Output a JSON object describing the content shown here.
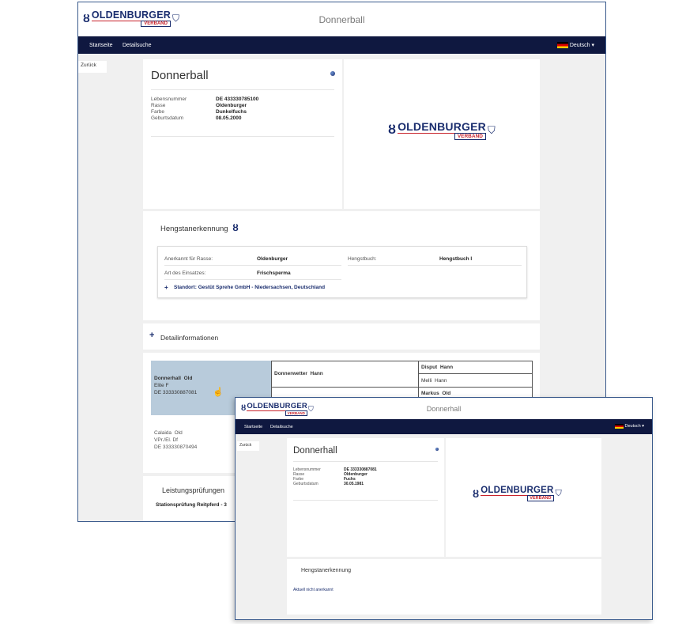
{
  "brand": {
    "name": "OLDENBURGER",
    "sub": "VERBAND"
  },
  "icons": {
    "emblem": "horse-emblem-icon",
    "shield": "shield-icon",
    "expand": "plus-icon",
    "cursor": "hand-cursor-icon"
  },
  "colors": {
    "navbar": "#0f1840",
    "accent_red": "#c8232c",
    "brand_blue": "#1a2d6e",
    "highlight": "#b8cbdb"
  },
  "nav": {
    "home": "Startseite",
    "search": "Detailsuche",
    "language": "Deutsch ▾"
  },
  "back": "Zurück",
  "window1": {
    "title": "Donnerball",
    "horse": {
      "name": "Donnerball",
      "fields": [
        {
          "label": "Lebensnummer",
          "value": "DE 433330785100"
        },
        {
          "label": "Rasse",
          "value": "Oldenburger"
        },
        {
          "label": "Farbe",
          "value": "Dunkelfuchs"
        },
        {
          "label": "Geburtsdatum",
          "value": "08.05.2000"
        }
      ]
    },
    "hengst": {
      "title": "Hengstanerkennung",
      "anerkannt_label": "Anerkannt für Rasse:",
      "anerkannt_value": "Oldenburger",
      "hengstbuch_label": "Hengstbuch:",
      "hengstbuch_value": "Hengstbuch I",
      "einsatz_label": "Art des Einsatzes:",
      "einsatz_value": "Frischsperma",
      "standort": "Standort: Gestüt Sprehe GmbH - Niedersachsen, Deutschland"
    },
    "details": "Detailinformationen",
    "pedigree": {
      "sire_name": "Donnerhall",
      "sire_breed": "Old",
      "sire_line2": "Elite  F",
      "sire_number": "DE 333330887081",
      "gs_name": "Donnerwetter",
      "gs_breed": "Hann",
      "ggs1_name": "Disput",
      "ggs1_breed": "Hann",
      "ggd1_name": "Melli",
      "ggd1_breed": "Hann",
      "ggs2_name": "Markus",
      "ggs2_breed": "Old",
      "dam_name": "Calaida",
      "dam_breed": "Old",
      "dam_line2": "VPr./El.  Df",
      "dam_number": "DE 333330870494"
    },
    "leistung": {
      "title": "Leistungsprüfungen",
      "item": "Stationsprüfung Reitpferd - 3"
    }
  },
  "window2": {
    "title": "Donnerhall",
    "horse": {
      "name": "Donnerhall",
      "fields": [
        {
          "label": "Lebensnummer",
          "value": "DE 333330887081"
        },
        {
          "label": "Rasse",
          "value": "Oldenburger"
        },
        {
          "label": "Farbe",
          "value": "Fuchs"
        },
        {
          "label": "Geburtsdatum",
          "value": "30.05.1981"
        }
      ]
    },
    "hengst": {
      "title": "Hengstanerkennung",
      "status": "Aktuell nicht anerkannt"
    }
  }
}
